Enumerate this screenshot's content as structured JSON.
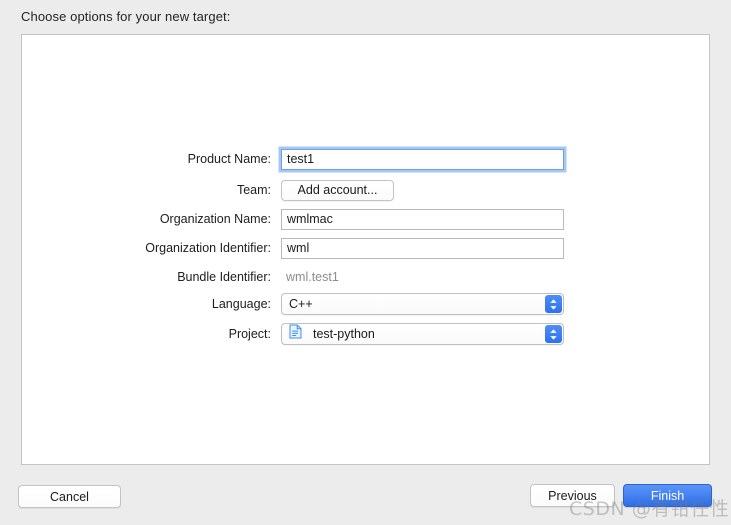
{
  "dialog": {
    "prompt": "Choose options for your new target:"
  },
  "form": {
    "rows": [
      {
        "label": "Product Name:",
        "type": "textfield",
        "value": "test1",
        "placeholder": "",
        "focused": true,
        "name": "product-name"
      },
      {
        "label": "Team:",
        "type": "button",
        "value": "Add account...",
        "name": "team"
      },
      {
        "label": "Organization Name:",
        "type": "textfield",
        "value": "wmlmac",
        "placeholder": "",
        "focused": false,
        "name": "organization-name"
      },
      {
        "label": "Organization Identifier:",
        "type": "textfield",
        "value": "wml",
        "placeholder": "",
        "focused": false,
        "name": "organization-identifier"
      },
      {
        "label": "Bundle Identifier:",
        "type": "static",
        "value": "wml.test1",
        "name": "bundle-identifier"
      },
      {
        "label": "Language:",
        "type": "popup",
        "value": "C++",
        "icon": "",
        "name": "language"
      },
      {
        "label": "Project:",
        "type": "popup",
        "value": "test-python",
        "icon": "document-icon",
        "name": "project"
      }
    ]
  },
  "footer": {
    "cancel_label": "Cancel",
    "previous_label": "Previous",
    "finish_label": "Finish"
  },
  "watermark": {
    "text": "CSDN @有钳任性"
  },
  "colors": {
    "window_background": "#ececec",
    "panel_background": "#ffffff",
    "panel_border": "#c4c4c4",
    "focus_ring": "#a8c7f5",
    "accent_blue": "#2e6fe8",
    "stepper_blue": "#3d7df4",
    "muted_text": "#8d8d8d",
    "text": "#1b1b1b"
  }
}
